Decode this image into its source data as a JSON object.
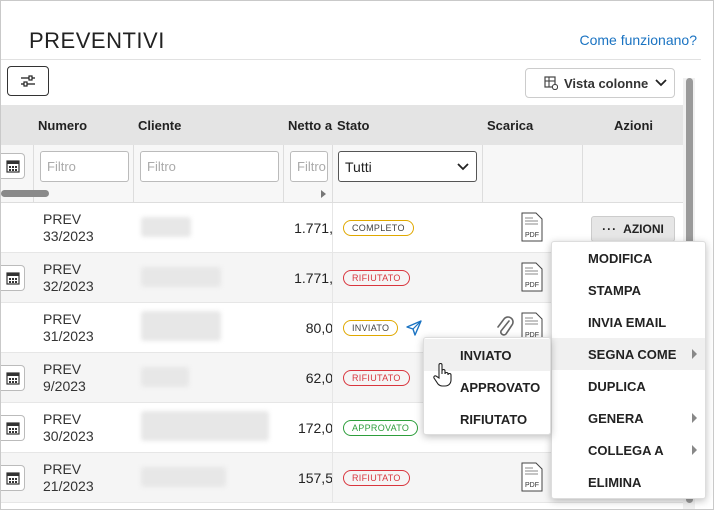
{
  "page": {
    "title": "PREVENTIVI",
    "help_link": "Come funzionano?"
  },
  "toolbar": {
    "columns_view_label": "Vista colonne"
  },
  "table": {
    "headers": {
      "numero": "Numero",
      "cliente": "Cliente",
      "netto": "Netto a",
      "stato": "Stato",
      "scarica": "Scarica",
      "azioni": "Azioni"
    },
    "filters": {
      "numero_placeholder": "Filtro",
      "cliente_placeholder": "Filtro",
      "netto_placeholder": "Filtro",
      "stato_value": "Tutti"
    },
    "rows": [
      {
        "num1": "PREV",
        "num2": "33/2023",
        "amount": "1.771,",
        "status": "COMPLETO",
        "pdf": "PDF"
      },
      {
        "num1": "PREV",
        "num2": "32/2023",
        "amount": "1.771,",
        "status": "RIFIUTATO",
        "pdf": "PDF"
      },
      {
        "num1": "PREV",
        "num2": "31/2023",
        "amount": "80,0",
        "status": "INVIATO",
        "pdf": "PDF"
      },
      {
        "num1": "PREV",
        "num2": "9/2023",
        "amount": "62,0",
        "status": "RIFIUTATO",
        "pdf": "PDF"
      },
      {
        "num1": "PREV",
        "num2": "30/2023",
        "amount": "172,0",
        "status": "APPROVATO",
        "pdf": "PDF"
      },
      {
        "num1": "PREV",
        "num2": "21/2023",
        "amount": "157,5",
        "status": "RIFIUTATO",
        "pdf": "PDF"
      }
    ]
  },
  "actions_button": {
    "label": "AZIONI"
  },
  "actions_menu": [
    "MODIFICA",
    "STAMPA",
    "INVIA EMAIL",
    "SEGNA COME",
    "DUPLICA",
    "GENERA",
    "COLLEGA A",
    "ELIMINA"
  ],
  "status_submenu": [
    "INVIATO",
    "APPROVATO",
    "RIFIUTATO"
  ],
  "colors": {
    "link": "#1a73c2",
    "rifiutato": "#d9363e",
    "approvato": "#2e9e3c",
    "pending": "#e0a800",
    "send_icon": "#1a73c2"
  }
}
